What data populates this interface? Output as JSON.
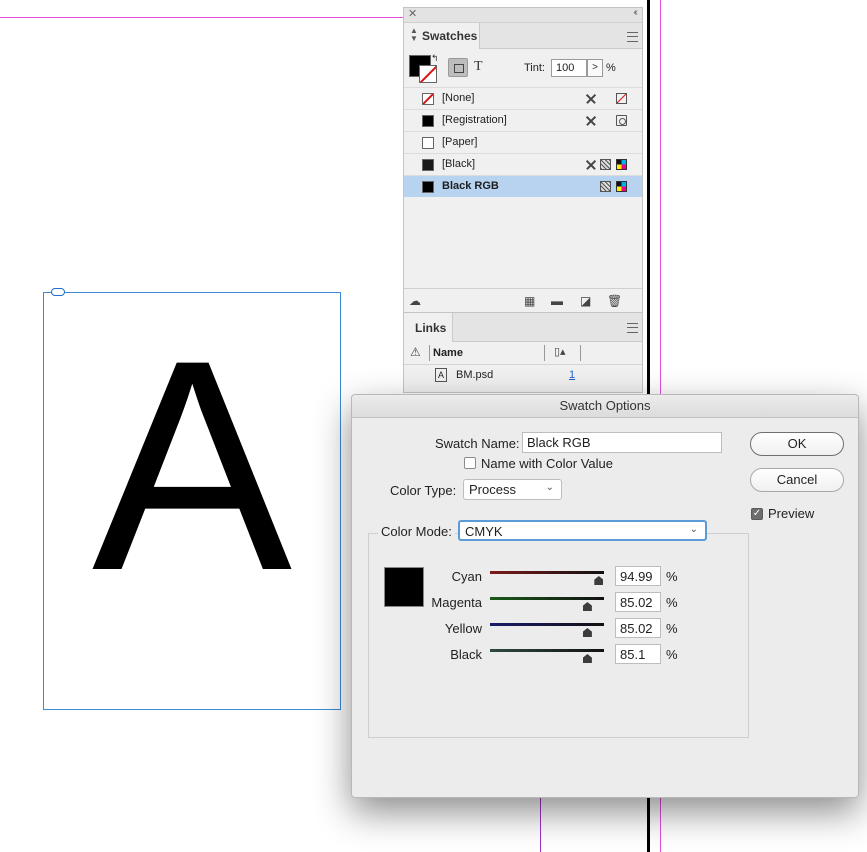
{
  "canvas": {
    "frame_letter": "A"
  },
  "swatches_panel": {
    "tab_label": "Swatches",
    "tint_label": "Tint:",
    "tint_value": "100",
    "tint_step": ">",
    "tint_unit": "%",
    "text_toggle": "T",
    "items": [
      {
        "name": "[None]",
        "chip": "none",
        "selected": false
      },
      {
        "name": "[Registration]",
        "chip": "black",
        "selected": false
      },
      {
        "name": "[Paper]",
        "chip": "paper",
        "selected": false
      },
      {
        "name": "[Black]",
        "chip": "dark",
        "selected": false
      },
      {
        "name": "Black RGB",
        "chip": "black",
        "selected": true
      }
    ]
  },
  "links_panel": {
    "tab_label": "Links",
    "column_name": "Name",
    "rows": [
      {
        "name": "BM.psd",
        "page": "1"
      }
    ]
  },
  "dialog": {
    "title": "Swatch Options",
    "swatch_name_label": "Swatch Name:",
    "swatch_name_value": "Black RGB",
    "name_with_color_label": "Name with Color Value",
    "name_with_color_checked": false,
    "color_type_label": "Color Type:",
    "color_type_value": "Process",
    "color_mode_label": "Color Mode:",
    "color_mode_value": "CMYK",
    "ok_label": "OK",
    "cancel_label": "Cancel",
    "preview_label": "Preview",
    "preview_checked": true,
    "unit": "%",
    "sliders": [
      {
        "label": "Cyan",
        "value": "94.99",
        "fraction": 0.95,
        "color": "#7a1a1a"
      },
      {
        "label": "Magenta",
        "value": "85.02",
        "fraction": 0.85,
        "color": "#1a5a1a"
      },
      {
        "label": "Yellow",
        "value": "85.02",
        "fraction": 0.85,
        "color": "#1a1a6a"
      },
      {
        "label": "Black",
        "value": "85.1",
        "fraction": 0.85,
        "color": "#2f4a3f"
      }
    ]
  },
  "colors": {
    "selection": "#b7d3f0",
    "frame_border": "#3c8ad6",
    "margin": "#e24ee2"
  }
}
